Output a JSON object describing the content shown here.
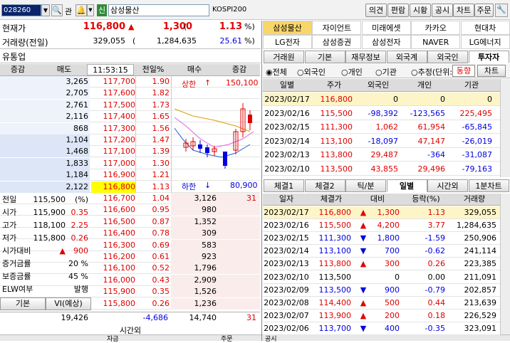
{
  "top": {
    "code": "028260",
    "gwan": "관",
    "bell_icon": "bell-icon",
    "sin": "신",
    "name": "삼성물산",
    "market": "KOSPI200",
    "buttons": [
      "의견",
      "편람",
      "시황",
      "공시",
      "차트",
      "주문"
    ]
  },
  "summary": {
    "price_label": "현재가",
    "price": "116,800",
    "arrow": "▲",
    "change": "1,300",
    "paren_open": "(",
    "pct": "1.13",
    "pct_unit": "%)",
    "volume_label": "거래량(전일)",
    "volume": "329,055",
    "prev_open": "(",
    "prev_volume": "1,284,635",
    "vol_ratio": "25.61",
    "vol_unit": "%)"
  },
  "stock_links": [
    [
      "삼성물산",
      "자이언트",
      "미래에셋",
      "카카오",
      "현대차"
    ],
    [
      "LG전자",
      "삼성증권",
      "삼성전자",
      "NAVER",
      "LG에너지"
    ]
  ],
  "ob_title": "유통업",
  "ob_header": [
    "증감",
    "매도",
    "11:53:15",
    "전일%",
    "매수",
    "증감"
  ],
  "asks": [
    [
      "3,265",
      "117,700",
      "1.90"
    ],
    [
      "2,705",
      "117,600",
      "1.82"
    ],
    [
      "2,761",
      "117,500",
      "1.73"
    ],
    [
      "2,116",
      "117,400",
      "1.65"
    ],
    [
      "868",
      "117,300",
      "1.56"
    ],
    [
      "1,104",
      "117,200",
      "1.47"
    ],
    [
      "1,468",
      "117,100",
      "1.39"
    ],
    [
      "1,833",
      "117,000",
      "1.30"
    ],
    [
      "1,184",
      "116,900",
      "1.21"
    ],
    [
      "2,122",
      "116,800",
      "1.13"
    ]
  ],
  "bids": [
    [
      "116,700",
      "1.04",
      "3,126",
      "31"
    ],
    [
      "116,600",
      "0.95",
      "980",
      ""
    ],
    [
      "116,500",
      "0.87",
      "1,352",
      ""
    ],
    [
      "116,400",
      "0.78",
      "309",
      ""
    ],
    [
      "116,300",
      "0.69",
      "583",
      ""
    ],
    [
      "116,200",
      "0.61",
      "923",
      ""
    ],
    [
      "116,100",
      "0.52",
      "1,796",
      ""
    ],
    [
      "116,000",
      "0.43",
      "2,909",
      ""
    ],
    [
      "115,900",
      "0.35",
      "1,526",
      ""
    ],
    [
      "115,800",
      "0.26",
      "1,236",
      ""
    ]
  ],
  "info": [
    [
      "전일",
      "115,500",
      "(%)",
      ""
    ],
    [
      "시가",
      "115,900",
      "0.35",
      "red"
    ],
    [
      "고가",
      "118,100",
      "2.25",
      "red"
    ],
    [
      "저가",
      "115,800",
      "0.26",
      "red"
    ],
    [
      "시가대비",
      "▲",
      "900",
      "red"
    ],
    [
      "증거금률",
      "",
      "20 %",
      ""
    ],
    [
      "보증금률",
      "",
      "45 %",
      ""
    ],
    [
      "ELW여부",
      "",
      "발행",
      ""
    ]
  ],
  "info_btns": [
    "기본",
    "VI(예상)"
  ],
  "totals": {
    "ask_total": "19,426",
    "diff": "-4,686",
    "bid_total": "14,740",
    "bid_diff": "31",
    "after": "시간외"
  },
  "bottom_left": [
    "자금",
    "주문"
  ],
  "mini_chart": {
    "upper_label": "상한",
    "upper_arrow": "↑",
    "upper_price": "150,100",
    "lower_label": "하한",
    "lower_arrow": "↓",
    "lower_price": "80,900"
  },
  "inv_tabs": [
    "거래원",
    "기본",
    "재무정보",
    "외국계",
    "외국인",
    "투자자"
  ],
  "inv_opts": [
    "전체",
    "외국인",
    "개인",
    "기관",
    "추정(단위:주)"
  ],
  "inv_btns": [
    "동향",
    "차트"
  ],
  "inv_header": [
    "일별",
    "주가",
    "외국인",
    "개인",
    "기관"
  ],
  "inv_rows": [
    [
      "2023/02/17",
      "116,800",
      "0",
      "0",
      "0"
    ],
    [
      "2023/02/16",
      "115,500",
      "-98,392",
      "-123,565",
      "225,495"
    ],
    [
      "2023/02/15",
      "111,300",
      "1,062",
      "61,954",
      "-65,845"
    ],
    [
      "2023/02/14",
      "113,100",
      "-18,097",
      "47,147",
      "-26,019"
    ],
    [
      "2023/02/13",
      "113,800",
      "29,487",
      "-364",
      "-31,087"
    ],
    [
      "2023/02/10",
      "113,500",
      "43,855",
      "29,496",
      "-79,163"
    ]
  ],
  "day_tabs": [
    "체결1",
    "체결2",
    "틱/분",
    "일별",
    "시간외",
    "1분차트"
  ],
  "day_header": [
    "일자",
    "체결가",
    "대비",
    "등락(%)",
    "거래량"
  ],
  "day_rows": [
    [
      "2023/02/17",
      "116,800",
      "▲",
      "1,300",
      "1.13",
      "329,055",
      "u"
    ],
    [
      "2023/02/16",
      "115,500",
      "▲",
      "4,200",
      "3.77",
      "1,284,635",
      "u"
    ],
    [
      "2023/02/15",
      "111,300",
      "▼",
      "1,800",
      "-1.59",
      "250,906",
      "d"
    ],
    [
      "2023/02/14",
      "113,100",
      "▼",
      "700",
      "-0.62",
      "241,114",
      "d"
    ],
    [
      "2023/02/13",
      "113,800",
      "▲",
      "300",
      "0.26",
      "223,385",
      "u"
    ],
    [
      "2023/02/10",
      "113,500",
      "",
      "0",
      "0.00",
      "211,091",
      "n"
    ],
    [
      "2023/02/09",
      "113,500",
      "▼",
      "900",
      "-0.79",
      "202,857",
      "d"
    ],
    [
      "2023/02/08",
      "114,400",
      "▲",
      "500",
      "0.44",
      "213,639",
      "u"
    ],
    [
      "2023/02/07",
      "113,900",
      "▲",
      "200",
      "0.18",
      "226,529",
      "u"
    ],
    [
      "2023/02/06",
      "113,700",
      "▼",
      "400",
      "-0.35",
      "323,091",
      "d"
    ]
  ],
  "status": "공시"
}
